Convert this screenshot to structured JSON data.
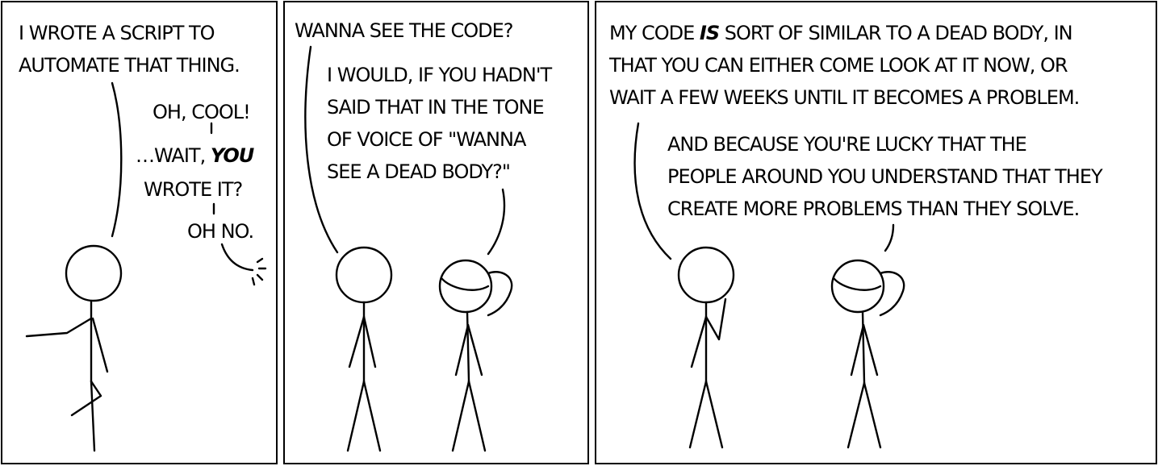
{
  "panels": [
    {
      "caption_lines": [
        "I WROTE A SCRIPT TO",
        "AUTOMATE THAT THING."
      ],
      "reply_line_1": "OH, COOL!",
      "reply_line_2_prefix": "…WAIT, ",
      "reply_line_2_emphasis": "YOU",
      "reply_line_3": "WROTE IT?",
      "reply_line_4": "OH NO."
    },
    {
      "caption": "WANNA SEE THE CODE?",
      "reply_lines": [
        "I WOULD, IF YOU HADN'T",
        "SAID THAT IN THE TONE",
        "OF VOICE OF \"WANNA",
        "SEE A DEAD BODY?\""
      ]
    },
    {
      "line_1_prefix": "MY CODE ",
      "line_1_emphasis": "IS",
      "line_1_suffix": " SORT OF SIMILAR TO A DEAD BODY, IN",
      "lines_rest": [
        "THAT YOU CAN EITHER COME LOOK AT IT NOW, OR",
        "WAIT A FEW WEEKS UNTIL IT BECOMES A PROBLEM."
      ],
      "reply_lines": [
        "AND BECAUSE YOU'RE LUCKY THAT THE",
        "PEOPLE AROUND YOU UNDERSTAND THAT THEY",
        "CREATE MORE PROBLEMS THAN THEY SOLVE."
      ]
    }
  ]
}
